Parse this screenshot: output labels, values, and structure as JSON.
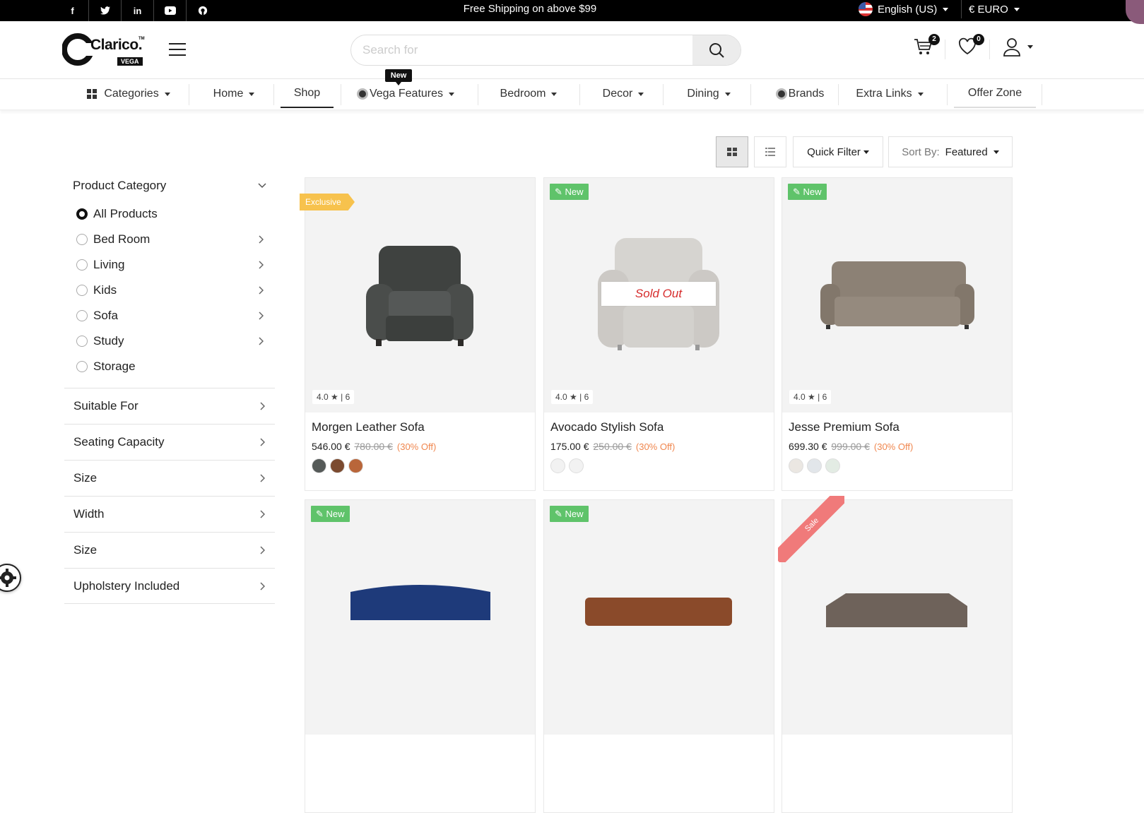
{
  "topbar": {
    "social": [
      "f",
      "t",
      "in",
      "yt",
      "gh"
    ],
    "shipping_text": "Free Shipping on above $99",
    "language": "English (US)",
    "currency": "€ EURO"
  },
  "header": {
    "logo_text": "Clarico.",
    "logo_sub": "VEGA",
    "logo_tm": "TM",
    "search_placeholder": "Search for",
    "cart_count": "2",
    "wishlist_count": "0"
  },
  "nav": {
    "new_badge": "New",
    "items": [
      "Categories",
      "Home",
      "Shop",
      "Vega Features",
      "Bedroom",
      "Decor",
      "Dining",
      "Brands",
      "Extra Links",
      "Offer Zone"
    ]
  },
  "toolbar": {
    "quick_filter": "Quick Filter",
    "sort_label": "Sort By:",
    "sort_value": "Featured"
  },
  "sidebar": {
    "category_heading": "Product Category",
    "categories": [
      "All Products",
      "Bed Room",
      "Living",
      "Kids",
      "Sofa",
      "Study",
      "Storage"
    ],
    "filters": [
      "Suitable For",
      "Seating Capacity",
      "Size",
      "Width",
      "Size",
      "Upholstery Included"
    ]
  },
  "products": [
    {
      "name": "Morgen Leather Sofa",
      "price": "546.00 €",
      "old_price": "780.00 €",
      "discount": "(30% Off)",
      "rating": "4.0",
      "reviews": "| 6",
      "tag": "Exclusive",
      "swatches": [
        "#555a58",
        "#7b4a2f",
        "#b9663a"
      ]
    },
    {
      "name": "Avocado Stylish Sofa",
      "price": "175.00 €",
      "old_price": "250.00 €",
      "discount": "(30% Off)",
      "rating": "4.0",
      "reviews": "| 6",
      "tag": "New",
      "status": "Sold Out"
    },
    {
      "name": "Jesse Premium Sofa",
      "price": "699.30 €",
      "old_price": "999.00 €",
      "discount": "(30% Off)",
      "rating": "4.0",
      "reviews": "| 6",
      "tag": "New"
    },
    {
      "tag": "New"
    },
    {
      "tag": "New"
    },
    {
      "tag": "Sale"
    }
  ],
  "colors": {
    "accent_new": "#5fc36a",
    "exclusive": "#f7c24d",
    "sale": "#f07a7a",
    "sold_out": "#d62c2c",
    "discount": "#f0874f"
  }
}
